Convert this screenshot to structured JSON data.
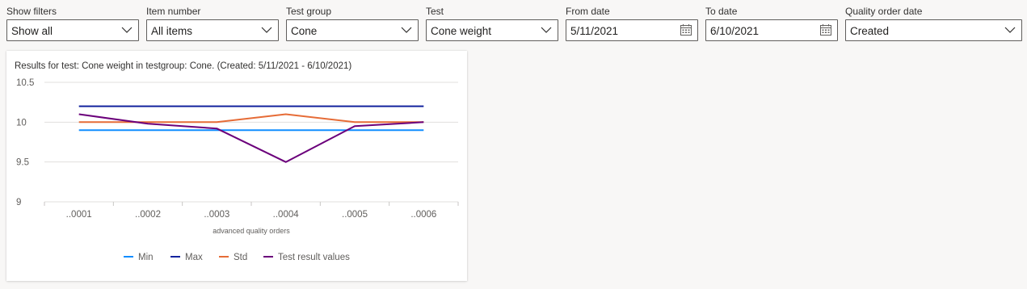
{
  "filters": [
    {
      "label": "Show filters",
      "value": "Show all",
      "icon": "chevron-down-icon"
    },
    {
      "label": "Item number",
      "value": "All items",
      "icon": "chevron-down-icon"
    },
    {
      "label": "Test group",
      "value": "Cone",
      "icon": "chevron-down-icon"
    },
    {
      "label": "Test",
      "value": "Cone weight",
      "icon": "chevron-down-icon"
    },
    {
      "label": "From date",
      "value": "5/11/2021",
      "icon": "calendar-icon"
    },
    {
      "label": "To date",
      "value": "6/10/2021",
      "icon": "calendar-icon"
    },
    {
      "label": "Quality order date",
      "value": "Created",
      "icon": "chevron-down-icon"
    }
  ],
  "chart_data": {
    "type": "line",
    "title": "Results for test: Cone weight in testgroup: Cone. (Created: 5/11/2021 - 6/10/2021)",
    "xlabel": "advanced quality orders",
    "ylabel": "",
    "categories": [
      "..0001",
      "..0002",
      "..0003",
      "..0004",
      "..0005",
      "..0006"
    ],
    "ylim": [
      9,
      10.5
    ],
    "yticks": [
      "10.5",
      "10",
      "9.5",
      "9"
    ],
    "legend_position": "bottom",
    "grid": true,
    "series": [
      {
        "name": "Min",
        "color": "#118dff",
        "values": [
          9.9,
          9.9,
          9.9,
          9.9,
          9.9,
          9.9
        ]
      },
      {
        "name": "Max",
        "color": "#12239e",
        "values": [
          10.2,
          10.2,
          10.2,
          10.2,
          10.2,
          10.2
        ]
      },
      {
        "name": "Std",
        "color": "#e66c37",
        "values": [
          10.0,
          10.0,
          10.0,
          10.1,
          10.0,
          10.0
        ]
      },
      {
        "name": "Test result values",
        "color": "#6b007b",
        "values": [
          10.1,
          9.98,
          9.92,
          9.5,
          9.95,
          10.0
        ]
      }
    ]
  }
}
